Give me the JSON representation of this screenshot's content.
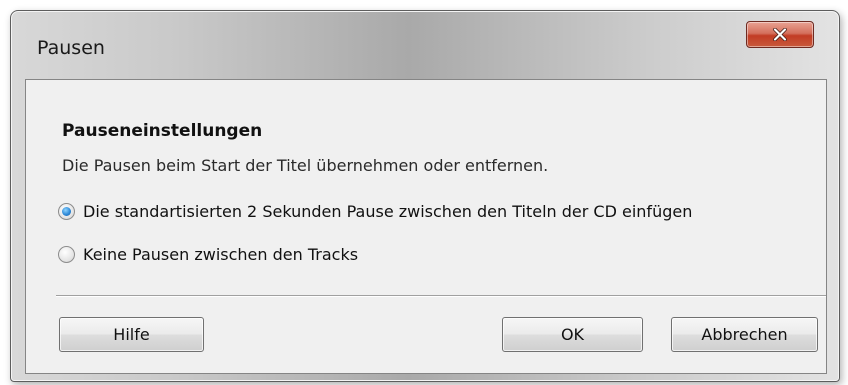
{
  "window": {
    "title": "Pausen",
    "close_icon": "close-x-icon",
    "accent_close": "#c8452c"
  },
  "content": {
    "heading": "Pauseneinstellungen",
    "description": "Die Pausen beim Start der Titel übernehmen oder entfernen."
  },
  "options": [
    {
      "label": "Die standartisierten 2 Sekunden Pause zwischen den Titeln der CD einfügen",
      "selected": true
    },
    {
      "label": "Keine Pausen zwischen den Tracks",
      "selected": false
    }
  ],
  "buttons": {
    "help": "Hilfe",
    "ok": "OK",
    "cancel": "Abbrechen"
  }
}
